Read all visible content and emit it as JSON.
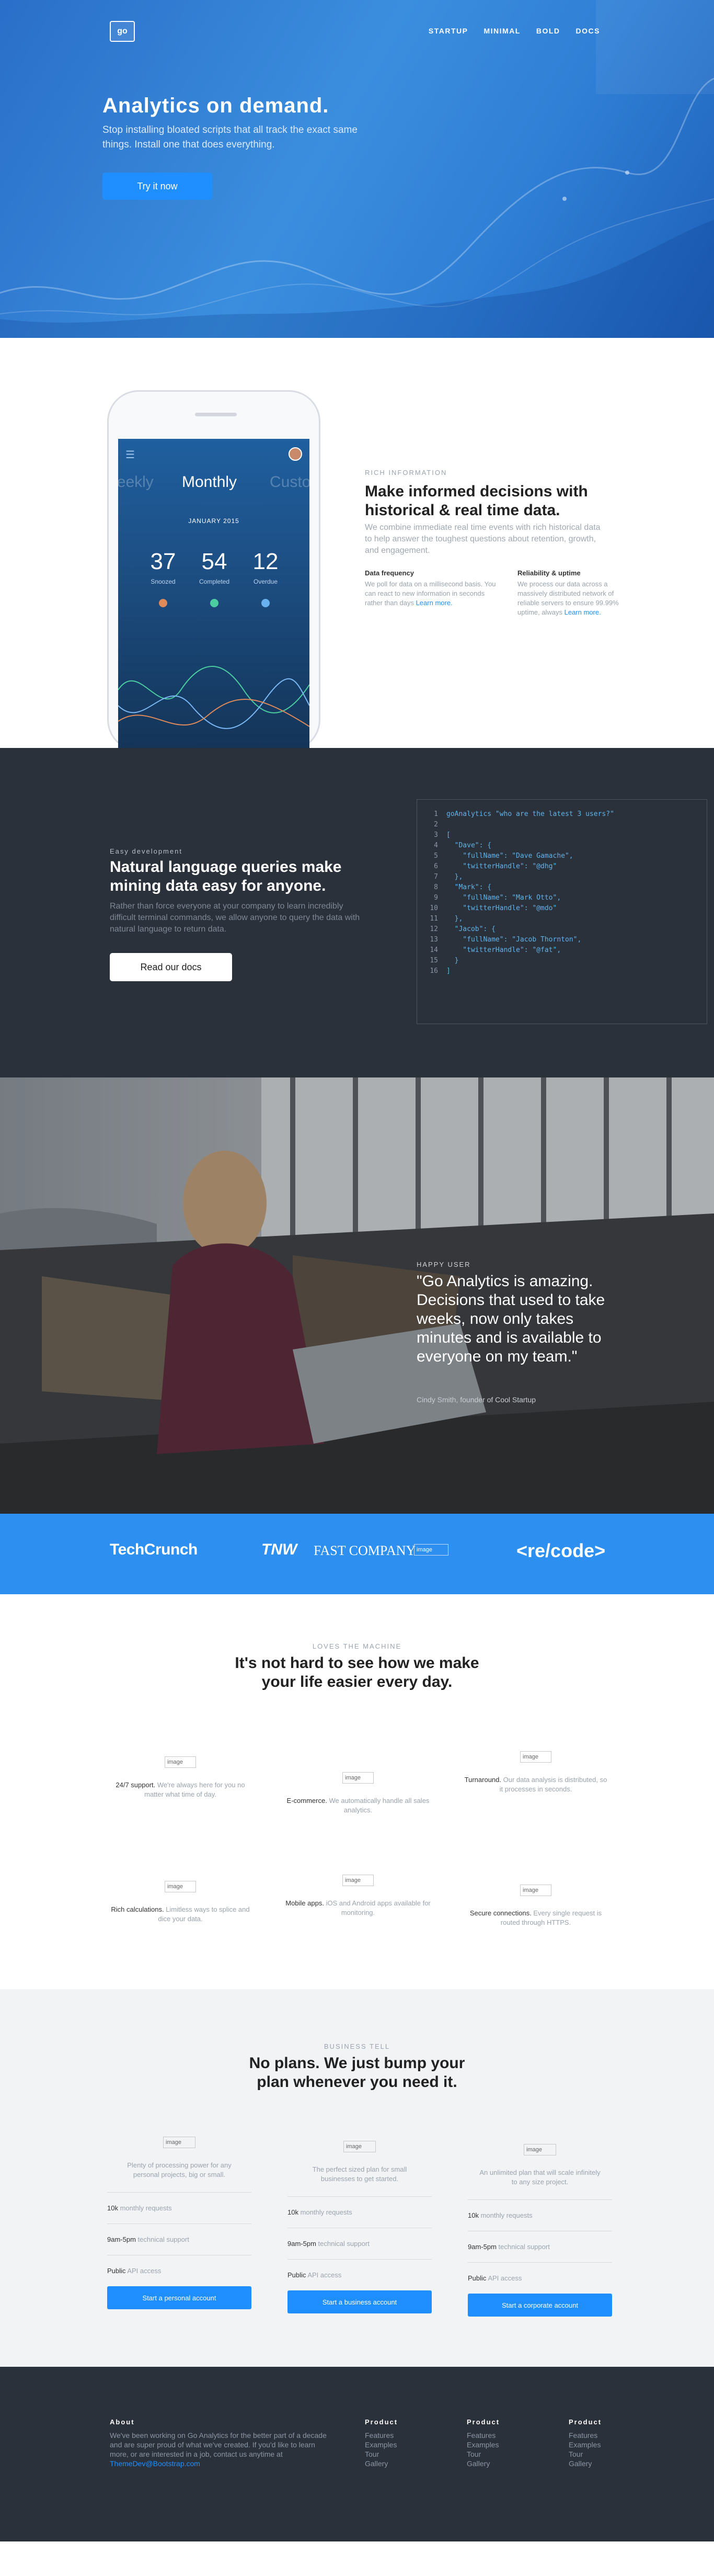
{
  "nav": {
    "logo": "go",
    "links": [
      "STARTUP",
      "MINIMAL",
      "BOLD",
      "DOCS"
    ]
  },
  "hero": {
    "title": "Analytics on demand.",
    "subtitle": "Stop installing bloated scripts that all track the exact same things. Install one that does everything.",
    "cta": "Try it now"
  },
  "feature": {
    "kicker": "RICH INFORMATION",
    "title": "Make informed decisions with historical & real time data.",
    "description": "We combine immediate real time events with rich historical data to help answer the toughest questions about retention, growth, and engagement.",
    "col1": {
      "heading": "Data frequency",
      "text": "We poll for data on a millisecond basis. You can react to new information in seconds rather than days",
      "link": "Learn more."
    },
    "col2": {
      "heading": "Reliability & uptime",
      "text": "We process our data across a massively distributed network of reliable servers to ensure 99.99% uptime, always",
      "link": "Learn more."
    },
    "phone": {
      "tabs": [
        "Weekly",
        "Monthly",
        "Custom"
      ],
      "date": "JANUARY 2015",
      "stats": [
        {
          "value": "37",
          "label": "Snoozed"
        },
        {
          "value": "54",
          "label": "Completed"
        },
        {
          "value": "12",
          "label": "Overdue"
        }
      ]
    }
  },
  "code": {
    "kicker": "Easy development",
    "title": "Natural language queries make mining data easy for anyone.",
    "description": "Rather than force everyone at your company to learn incredibly difficult terminal commands, we allow anyone to query the data with natural language to return data.",
    "button": "Read our docs",
    "lines": [
      {
        "n": "1",
        "text": "goAnalytics \"who are the latest 3 users?\""
      },
      {
        "n": "2",
        "text": ""
      },
      {
        "n": "3",
        "text": "["
      },
      {
        "n": "4",
        "text": "  \"Dave\": {"
      },
      {
        "n": "5",
        "text": "    \"fullName\": \"Dave Gamache\","
      },
      {
        "n": "6",
        "text": "    \"twitterHandle\": \"@dhg\""
      },
      {
        "n": "7",
        "text": "  },"
      },
      {
        "n": "8",
        "text": "  \"Mark\": {"
      },
      {
        "n": "9",
        "text": "    \"fullName\": \"Mark Otto\","
      },
      {
        "n": "10",
        "text": "    \"twitterHandle\": \"@mdo\""
      },
      {
        "n": "11",
        "text": "  },"
      },
      {
        "n": "12",
        "text": "  \"Jacob\": {"
      },
      {
        "n": "13",
        "text": "    \"fullName\": \"Jacob Thornton\","
      },
      {
        "n": "14",
        "text": "    \"twitterHandle\": \"@fat\","
      },
      {
        "n": "15",
        "text": "  }"
      },
      {
        "n": "16",
        "text": "]"
      }
    ]
  },
  "testimonial": {
    "kicker": "HAPPY USER",
    "quote": "\"Go Analytics is amazing. Decisions that used to take weeks, now only takes minutes and is available to everyone on my team.\"",
    "author": "Cindy Smith, founder of Cool Startup"
  },
  "press": {
    "logos": [
      "TechCrunch",
      "TNW",
      "FAST COMPANY",
      "image",
      "<re/code>"
    ]
  },
  "benefits": {
    "kicker": "LOVES THE MACHINE",
    "title": "It's not hard to see how we make your life easier every day.",
    "image_alt": "image",
    "items": [
      {
        "bold": "24/7 support.",
        "text": " We're always here for you no matter what time of day."
      },
      {
        "bold": "E-commerce.",
        "text": " We automatically handle all sales analytics."
      },
      {
        "bold": "Turnaround.",
        "text": " Our data analysis is distributed, so it processes in seconds."
      },
      {
        "bold": "Rich calculations.",
        "text": " Limitless ways to splice and dice your data."
      },
      {
        "bold": "Mobile apps.",
        "text": " iOS and Android apps available for monitoring."
      },
      {
        "bold": "Secure connections.",
        "text": " Every single request is routed through HTTPS."
      }
    ]
  },
  "pricing": {
    "kicker": "BUSINESS TELL",
    "title": "No plans. We just bump your plan whenever you need it.",
    "image_alt": "image",
    "plans": [
      {
        "desc": "Plenty of processing power for any personal projects, big or small.",
        "rows": [
          [
            "10k",
            " monthly requests"
          ],
          [
            "9am-5pm",
            " technical support"
          ],
          [
            "Public",
            " API access"
          ]
        ],
        "button": "Start a personal account"
      },
      {
        "desc": "The perfect sized plan for small businesses to get started.",
        "rows": [
          [
            "10k",
            " monthly requests"
          ],
          [
            "9am-5pm",
            " technical support"
          ],
          [
            "Public",
            " API access"
          ]
        ],
        "button": "Start a business account"
      },
      {
        "desc": "An unlimited plan that will scale infinitely to any size project.",
        "rows": [
          [
            "10k",
            " monthly requests"
          ],
          [
            "9am-5pm",
            " technical support"
          ],
          [
            "Public",
            " API access"
          ]
        ],
        "button": "Start a corporate account"
      }
    ]
  },
  "footer": {
    "about_heading": "About",
    "about_text": "We've been working on Go Analytics for the better part of a decade and are super proud of what we've created. If you'd like to learn more, or are interested in a job, contact us anytime at",
    "about_email": "ThemeDev@Bootstrap.com",
    "columns": [
      {
        "heading": "Product",
        "links": [
          "Features",
          "Examples",
          "Tour",
          "Gallery"
        ]
      },
      {
        "heading": "Product",
        "links": [
          "Features",
          "Examples",
          "Tour",
          "Gallery"
        ]
      },
      {
        "heading": "Product",
        "links": [
          "Features",
          "Examples",
          "Tour",
          "Gallery"
        ]
      }
    ]
  },
  "colors": {
    "accent": "#1f8fff",
    "dark": "#2b313b",
    "hero": "#2f7fd6"
  }
}
